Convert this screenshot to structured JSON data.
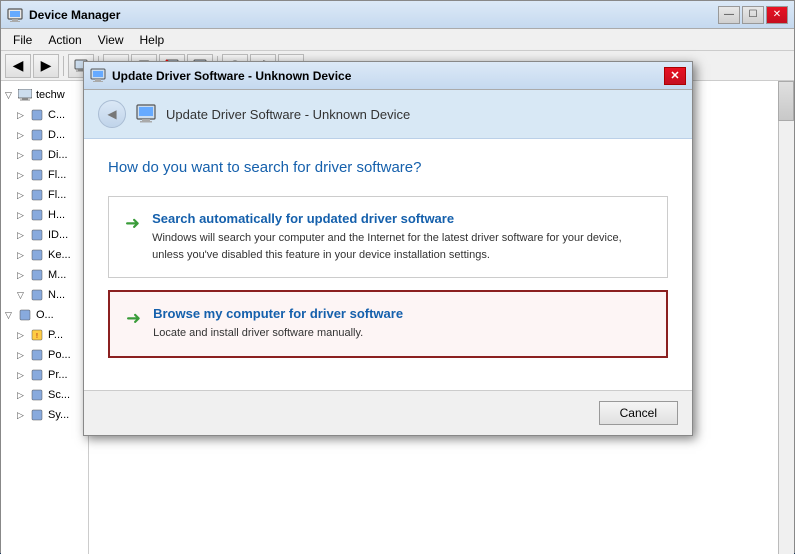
{
  "app": {
    "title": "Device Manager",
    "menu": {
      "items": [
        "File",
        "Action",
        "View",
        "Help"
      ]
    },
    "toolbar": {
      "buttons": [
        "←",
        "→",
        "⊞",
        "?",
        "▤",
        "⊟",
        "⊞",
        "↺",
        "⊕",
        "⊗",
        "✎"
      ]
    }
  },
  "tree": {
    "root": "techw",
    "items": [
      {
        "label": "C...",
        "indent": 1,
        "arrow": "▷"
      },
      {
        "label": "D...",
        "indent": 1,
        "arrow": "▷"
      },
      {
        "label": "Di...",
        "indent": 1,
        "arrow": "▷"
      },
      {
        "label": "Fl...",
        "indent": 1,
        "arrow": "▷"
      },
      {
        "label": "Fl...",
        "indent": 1,
        "arrow": "▷"
      },
      {
        "label": "H...",
        "indent": 1,
        "arrow": "▷"
      },
      {
        "label": "ID...",
        "indent": 1,
        "arrow": "▷"
      },
      {
        "label": "Ke...",
        "indent": 1,
        "arrow": "▷"
      },
      {
        "label": "M...",
        "indent": 1,
        "arrow": "▷"
      },
      {
        "label": "N...",
        "indent": 1,
        "arrow": "▽",
        "selected": false
      },
      {
        "label": "O...",
        "indent": 0,
        "arrow": "▽"
      },
      {
        "label": "P...",
        "indent": 1,
        "arrow": "▷"
      },
      {
        "label": "Po...",
        "indent": 1,
        "arrow": "▷"
      },
      {
        "label": "Pr...",
        "indent": 1,
        "arrow": "▷"
      },
      {
        "label": "Sc...",
        "indent": 1,
        "arrow": "▷"
      },
      {
        "label": "Sy...",
        "indent": 1,
        "arrow": "▷"
      }
    ]
  },
  "dialog": {
    "title_bar": {
      "title": "Update Driver Software - Unknown Device",
      "close_label": "✕"
    },
    "back_button_label": "◀",
    "question": "How do you want to search for driver software?",
    "options": [
      {
        "id": "auto",
        "title": "Search automatically for updated driver software",
        "description": "Windows will search your computer and the Internet for the latest driver software for your device, unless you've disabled this feature in your device installation settings.",
        "arrow": "➜",
        "selected": false
      },
      {
        "id": "browse",
        "title": "Browse my computer for driver software",
        "description": "Locate and install driver software manually.",
        "arrow": "➜",
        "selected": true
      }
    ],
    "footer": {
      "cancel_label": "Cancel"
    }
  },
  "colors": {
    "accent_blue": "#1560ac",
    "header_bg": "#d8e8f5",
    "selected_border": "#8b2020",
    "arrow_green": "#3a9c3a"
  }
}
